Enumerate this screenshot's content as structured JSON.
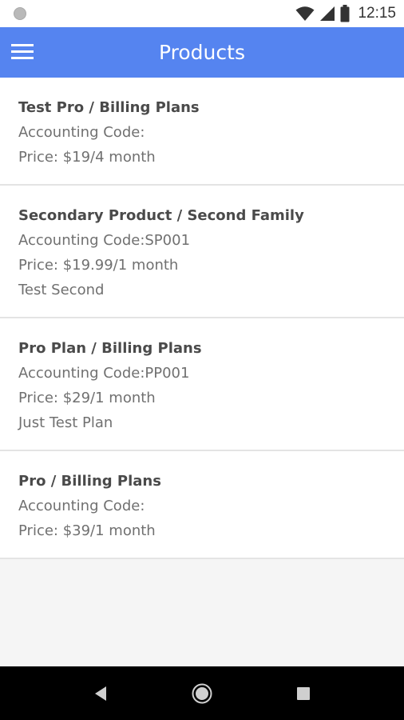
{
  "status_bar": {
    "time": "12:15",
    "icons": [
      "notification-dot-icon",
      "wifi-icon",
      "signal-icon",
      "battery-icon"
    ]
  },
  "app_bar": {
    "title": "Products",
    "menu_icon": "hamburger-menu-icon",
    "color": "#5584f0"
  },
  "products": [
    {
      "title": "Test Pro / Billing Plans",
      "accounting_code": "Accounting Code:",
      "price": "Price: $19/4 month",
      "description": ""
    },
    {
      "title": "Secondary Product / Second Family",
      "accounting_code": "Accounting Code:SP001",
      "price": "Price: $19.99/1 month",
      "description": "Test Second"
    },
    {
      "title": "Pro Plan / Billing Plans",
      "accounting_code": "Accounting Code:PP001",
      "price": "Price: $29/1 month",
      "description": "Just Test Plan"
    },
    {
      "title": "Pro / Billing Plans",
      "accounting_code": "Accounting Code:",
      "price": "Price: $39/1 month",
      "description": ""
    }
  ],
  "nav_bar": {
    "icons": [
      "back-icon",
      "home-icon",
      "recents-icon"
    ]
  }
}
